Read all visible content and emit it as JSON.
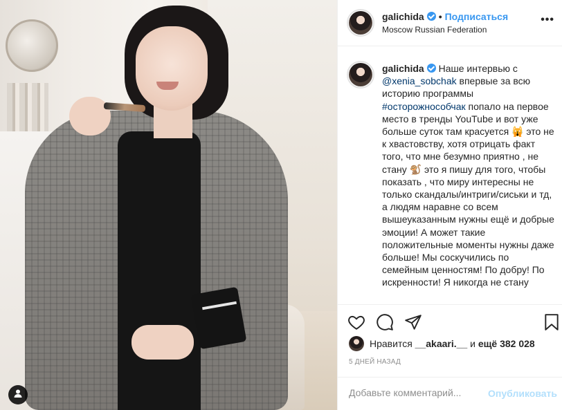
{
  "header": {
    "username": "galichida",
    "dot": "•",
    "follow_label": "Подписаться",
    "location": "Moscow Russian Federation",
    "more_label": "•••"
  },
  "caption": {
    "username": "galichida",
    "text_1": "Наше интервью с ",
    "mention": "@xenia_sobchak",
    "text_2": " впервые за всю историю программы ",
    "hashtag": "#осторожнособчак",
    "text_3": " попало на первое место в тренды YouTube и вот уже больше суток там красуется 🙀 это не к хвастовству, хотя отрицать факт того, что мне безумно приятно , не стану 🐒 это я пишу для того, чтобы показать , что миру интересны не только скандалы/интриги/сиськи и тд, а людям наравне со всем вышеуказанным нужны ещё и добрые эмоции! А может такие положительные моменты нужны даже больше! Мы соскучились по семейным ценностям! По добру! По искренности! Я никогда не стану"
  },
  "likes": {
    "prefix": "Нравится ",
    "user": "__akaari.__",
    "middle": " и ",
    "count_text": "ещё 382 028"
  },
  "time_ago": "5 ДНЕЙ НАЗАД",
  "comment_box": {
    "placeholder": "Добавьте комментарий...",
    "publish_label": "Опубликовать"
  },
  "icons": {
    "like": "heart-icon",
    "comment": "comment-icon",
    "share": "share-icon",
    "save": "bookmark-icon",
    "user_tags": "user-icon"
  },
  "colors": {
    "accent": "#3897f0",
    "publish_disabled": "#b2dffc",
    "muted": "#8e8e8e"
  }
}
